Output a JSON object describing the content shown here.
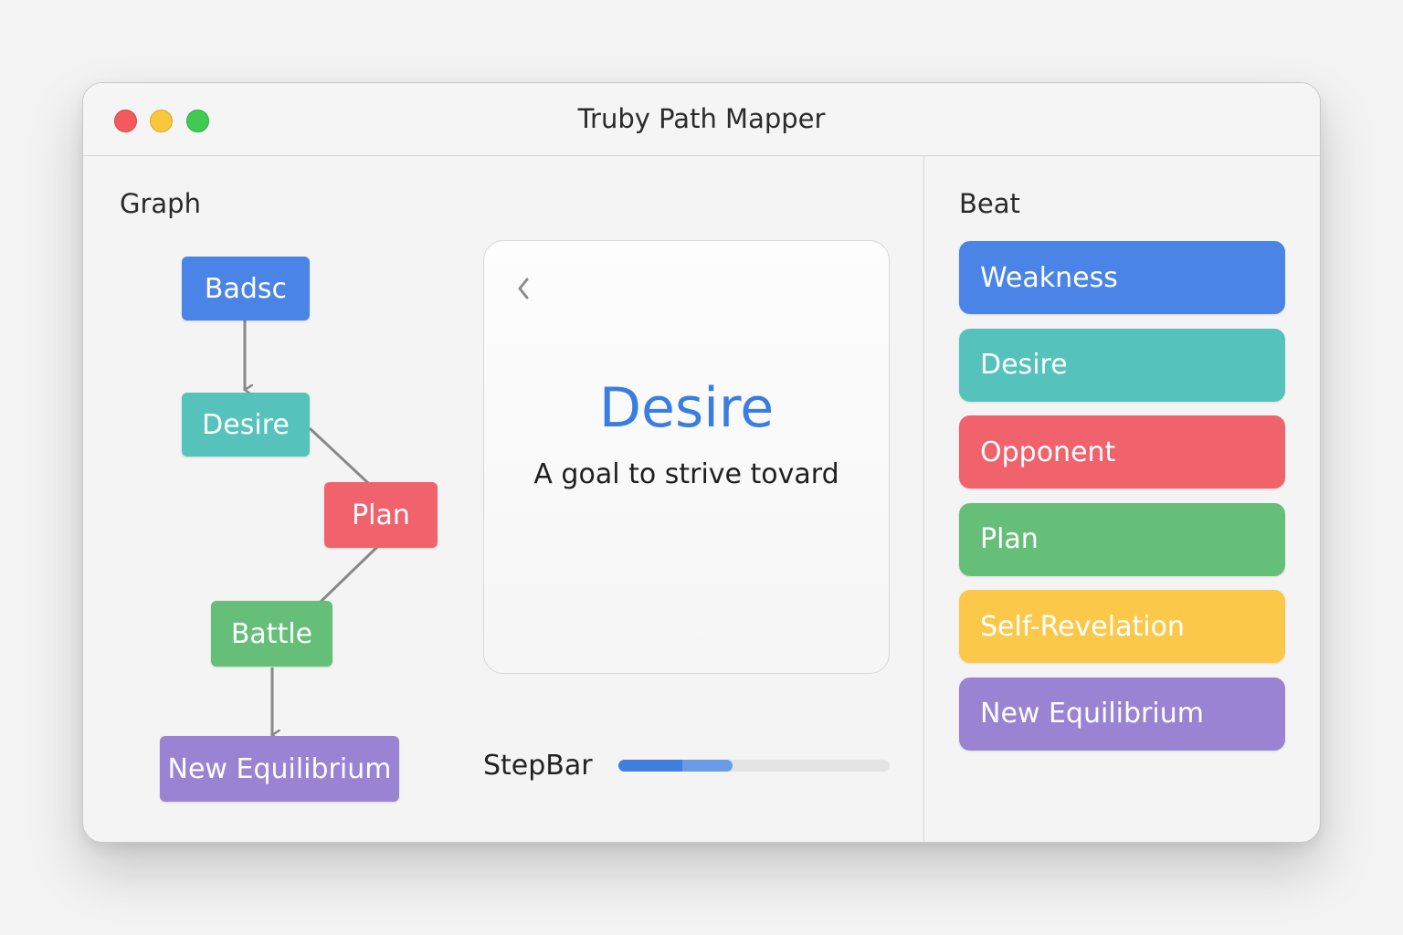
{
  "window": {
    "title": "Truby Path Mapper"
  },
  "graph": {
    "heading": "Graph",
    "nodes": {
      "badsc": {
        "label": "Badsc",
        "color": "#4a84e6"
      },
      "desire": {
        "label": "Desire",
        "color": "#55c3bc"
      },
      "plan": {
        "label": "Plan",
        "color": "#f0626c"
      },
      "battle": {
        "label": "Battle",
        "color": "#66bf78"
      },
      "new_equilibrium": {
        "label": "New Equilibrium",
        "color": "#9b83d3"
      }
    }
  },
  "card": {
    "title": "Desire",
    "subtitle": "A goal to strive tovard",
    "back_icon": "chevron-left-icon"
  },
  "stepbar": {
    "label": "StepBar",
    "progress": 0.42,
    "completed": 0.235
  },
  "beats": {
    "heading": "Beat",
    "items": [
      {
        "label": "Weakness",
        "color": "#4a84e6"
      },
      {
        "label": "Desire",
        "color": "#55c3bc"
      },
      {
        "label": "Opponent",
        "color": "#f0626c"
      },
      {
        "label": "Plan",
        "color": "#66bf78"
      },
      {
        "label": "Self-Revelation",
        "color": "#fcc84a"
      },
      {
        "label": "New Equilibrium",
        "color": "#9b83d3"
      }
    ]
  }
}
